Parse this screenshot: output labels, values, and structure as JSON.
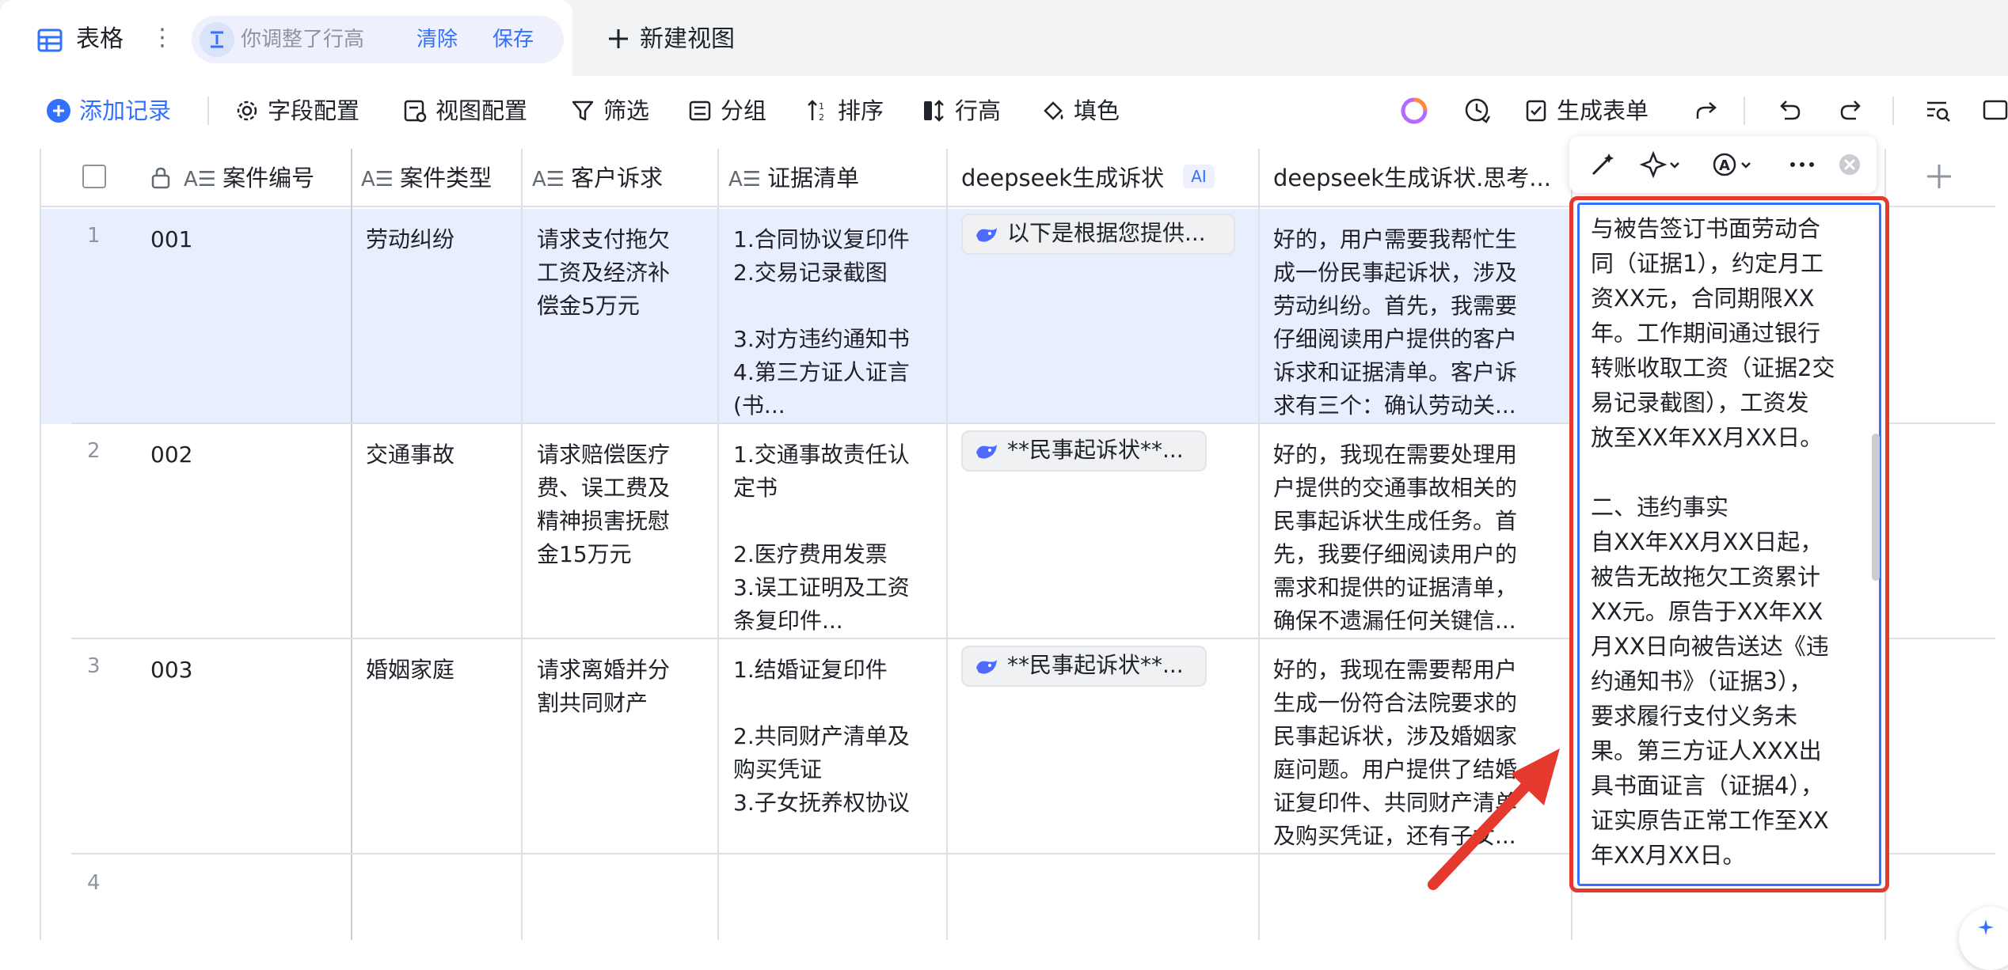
{
  "tab": {
    "title": "表格",
    "more": "⋮"
  },
  "row_height_pill": {
    "text": "你调整了行高",
    "clear": "清除",
    "save": "保存"
  },
  "new_view": "新建视图",
  "toolbar": {
    "add_record": "添加记录",
    "field_config": "字段配置",
    "view_config": "视图配置",
    "filter": "筛选",
    "group": "分组",
    "sort": "排序",
    "row_height": "行高",
    "fill_color": "填色",
    "generate_form": "生成表单"
  },
  "columns": {
    "case_no": "案件编号",
    "case_type": "案件类型",
    "claim": "客户诉求",
    "evidence": "证据清单",
    "ds_gen": "deepseek生成诉状",
    "ai_badge": "AI",
    "ds_think": "deepseek生成诉状.思考..."
  },
  "rows": [
    {
      "num": "1",
      "case_no": "001",
      "case_type": "劳动纠纷",
      "claim": "请求支付拖欠\n工资及经济补\n偿金5万元",
      "evidence": "1.合同协议复印件\n2.交易记录截图\n\n3.对方违约通知书\n4.第三方证人证言\n(书...",
      "ds_gen": "以下是根据您提供...",
      "ds_think": "好的，用户需要我帮忙生\n成一份民事起诉状，涉及\n劳动纠纷。首先，我需要\n仔细阅读用户提供的客户\n诉求和证据清单。客户诉\n求有三个：确认劳动关..."
    },
    {
      "num": "2",
      "case_no": "002",
      "case_type": "交通事故",
      "claim": "请求赔偿医疗\n费、误工费及\n精神损害抚慰\n金15万元",
      "evidence": "1.交通事故责任认\n定书\n\n2.医疗费用发票\n3.误工证明及工资\n条复印件...",
      "ds_gen": "**民事起诉状**...",
      "ds_think": "好的，我现在需要处理用\n户提供的交通事故相关的\n民事起诉状生成任务。首\n先，我要仔细阅读用户的\n需求和提供的证据清单，\n确保不遗漏任何关键信..."
    },
    {
      "num": "3",
      "case_no": "003",
      "case_type": "婚姻家庭",
      "claim": "请求离婚并分\n割共同财产",
      "evidence": "1.结婚证复印件\n\n2.共同财产清单及\n购买凭证\n3.子女抚养权协议",
      "ds_gen": "**民事起诉状**...",
      "ds_think": "好的，我现在需要帮用户\n生成一份符合法院要求的\n民事起诉状，涉及婚姻家\n庭问题。用户提供了结婚\n证复印件、共同财产清单\n及购买凭证，还有子女..."
    },
    {
      "num": "4"
    }
  ],
  "expanded_cell": "与被告签订书面劳动合\n同（证据1），约定月工\n资XX元，合同期限XX\n年。工作期间通过银行\n转账收取工资（证据2交\n易记录截图），工资发\n放至XX年XX月XX日。\n\n二、违约事实\n自XX年XX月XX日起，\n被告无故拖欠工资累计\nXX元。原告于XX年XX\n月XX日向被告送达《违\n约通知书》（证据3），\n要求履行支付义务未\n果。第三方证人XXX出\n具书面证言（证据4），\n证实原告正常工作至XX\n年XX月XX日。",
  "colors": {
    "accent": "#3370ff",
    "selected_row": "#e8eefd",
    "highlight": "#e5392e"
  }
}
